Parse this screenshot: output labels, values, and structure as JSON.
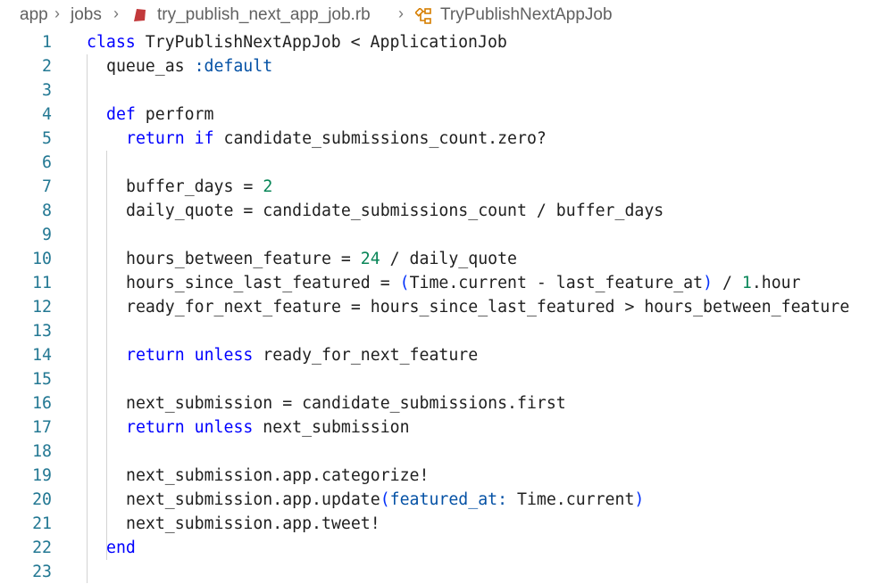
{
  "breadcrumb": {
    "items": [
      "app",
      "jobs",
      "try_publish_next_app_job.rb",
      "TryPublishNextAppJob"
    ],
    "separator": ">"
  },
  "editor": {
    "lines": [
      {
        "num": "1",
        "indent": 0,
        "tokens": [
          [
            "kw",
            "class"
          ],
          [
            "p",
            " TryPublishNextAppJob < ApplicationJob"
          ]
        ]
      },
      {
        "num": "2",
        "indent": 1,
        "tokens": [
          [
            "p",
            "queue_as "
          ],
          [
            "sym",
            ":default"
          ]
        ]
      },
      {
        "num": "3",
        "indent": 1,
        "tokens": []
      },
      {
        "num": "4",
        "indent": 1,
        "tokens": [
          [
            "kw",
            "def"
          ],
          [
            "p",
            " perform"
          ]
        ]
      },
      {
        "num": "5",
        "indent": 2,
        "tokens": [
          [
            "kw",
            "return"
          ],
          [
            "p",
            " "
          ],
          [
            "kw",
            "if"
          ],
          [
            "p",
            " candidate_submissions_count.zero?"
          ]
        ]
      },
      {
        "num": "6",
        "indent": 2,
        "tokens": []
      },
      {
        "num": "7",
        "indent": 2,
        "tokens": [
          [
            "p",
            "buffer_days = "
          ],
          [
            "num",
            "2"
          ]
        ]
      },
      {
        "num": "8",
        "indent": 2,
        "tokens": [
          [
            "p",
            "daily_quote = candidate_submissions_count / buffer_days"
          ]
        ]
      },
      {
        "num": "9",
        "indent": 2,
        "tokens": []
      },
      {
        "num": "10",
        "indent": 2,
        "tokens": [
          [
            "p",
            "hours_between_feature = "
          ],
          [
            "num",
            "24"
          ],
          [
            "p",
            " / daily_quote"
          ]
        ]
      },
      {
        "num": "11",
        "indent": 2,
        "tokens": [
          [
            "p",
            "hours_since_last_featured = "
          ],
          [
            "par",
            "("
          ],
          [
            "p",
            "Time.current - last_feature_at"
          ],
          [
            "par",
            ")"
          ],
          [
            "p",
            " / "
          ],
          [
            "num",
            "1"
          ],
          [
            "p",
            ".hour"
          ]
        ]
      },
      {
        "num": "12",
        "indent": 2,
        "tokens": [
          [
            "p",
            "ready_for_next_feature = hours_since_last_featured > hours_between_feature"
          ]
        ]
      },
      {
        "num": "13",
        "indent": 2,
        "tokens": []
      },
      {
        "num": "14",
        "indent": 2,
        "tokens": [
          [
            "kw",
            "return"
          ],
          [
            "p",
            " "
          ],
          [
            "kw",
            "unless"
          ],
          [
            "p",
            " ready_for_next_feature"
          ]
        ]
      },
      {
        "num": "15",
        "indent": 2,
        "tokens": []
      },
      {
        "num": "16",
        "indent": 2,
        "tokens": [
          [
            "p",
            "next_submission = candidate_submissions.first"
          ]
        ]
      },
      {
        "num": "17",
        "indent": 2,
        "tokens": [
          [
            "kw",
            "return"
          ],
          [
            "p",
            " "
          ],
          [
            "kw",
            "unless"
          ],
          [
            "p",
            " next_submission"
          ]
        ]
      },
      {
        "num": "18",
        "indent": 2,
        "tokens": []
      },
      {
        "num": "19",
        "indent": 2,
        "tokens": [
          [
            "p",
            "next_submission.app.categorize!"
          ]
        ]
      },
      {
        "num": "20",
        "indent": 2,
        "tokens": [
          [
            "p",
            "next_submission.app.update"
          ],
          [
            "par",
            "("
          ],
          [
            "key",
            "featured_at:"
          ],
          [
            "p",
            " Time.current"
          ],
          [
            "par",
            ")"
          ]
        ]
      },
      {
        "num": "21",
        "indent": 2,
        "tokens": [
          [
            "p",
            "next_submission.app.tweet!"
          ]
        ]
      },
      {
        "num": "22",
        "indent": 1,
        "tokens": [
          [
            "kw",
            "end"
          ]
        ]
      },
      {
        "num": "23",
        "indent": 1,
        "tokens": []
      }
    ]
  },
  "colors": {
    "keyword": "#0000ff",
    "symbol": "#0451a5",
    "number": "#098658",
    "line_number": "#237893",
    "ruby_icon": "#c2393b",
    "class_icon": "#d67e00"
  },
  "icons": {
    "file": "ruby-file-icon",
    "symbol": "class-symbol-icon"
  }
}
